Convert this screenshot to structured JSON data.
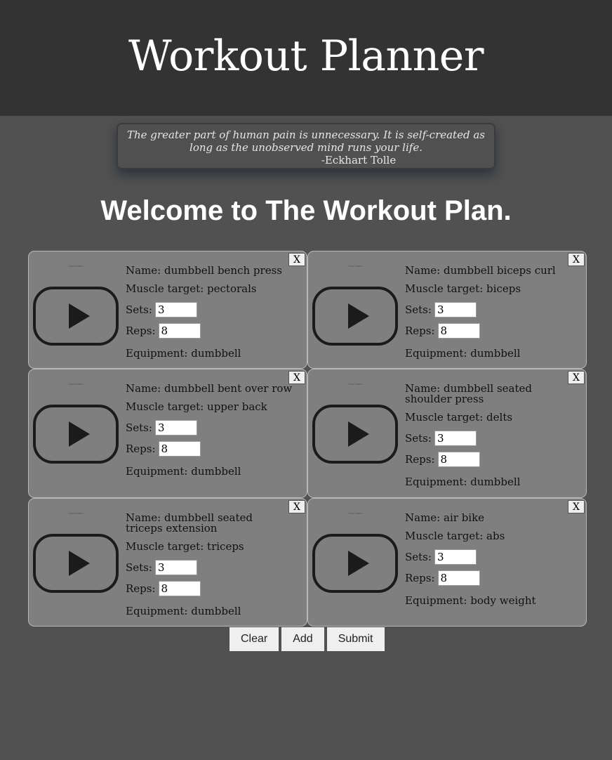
{
  "header": {
    "title": "Workout Planner"
  },
  "quote": {
    "text": "The greater part of human pain is unnecessary. It is self-created as long as the unobserved mind runs your life.",
    "author": "-Eckhart Tolle"
  },
  "welcome": "Welcome to The Workout Plan.",
  "labels": {
    "name": "Name:",
    "muscle": "Muscle target:",
    "sets": "Sets:",
    "reps": "Reps:",
    "equipment": "Equipment:",
    "remove": "X",
    "thumb_text": "Click Button"
  },
  "exercises": [
    {
      "name": "dumbbell bench press",
      "target": "pectorals",
      "sets": "3",
      "reps": "8",
      "equipment": "dumbbell"
    },
    {
      "name": "dumbbell biceps curl",
      "target": "biceps",
      "sets": "3",
      "reps": "8",
      "equipment": "dumbbell"
    },
    {
      "name": "dumbbell bent over row",
      "target": "upper back",
      "sets": "3",
      "reps": "8",
      "equipment": "dumbbell"
    },
    {
      "name": "dumbbell seated shoulder press",
      "target": "delts",
      "sets": "3",
      "reps": "8",
      "equipment": "dumbbell"
    },
    {
      "name": "dumbbell seated triceps extension",
      "target": "triceps",
      "sets": "3",
      "reps": "8",
      "equipment": "dumbbell"
    },
    {
      "name": "air bike",
      "target": "abs",
      "sets": "3",
      "reps": "8",
      "equipment": "body weight"
    }
  ],
  "actions": {
    "clear": "Clear",
    "add": "Add",
    "submit": "Submit"
  }
}
